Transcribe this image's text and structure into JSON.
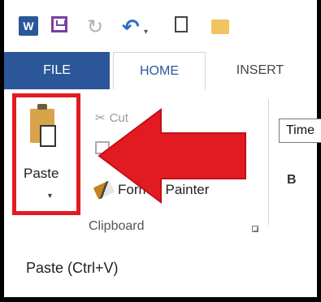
{
  "quick_access": {
    "word_badge": "W",
    "icons": [
      "word-icon",
      "save-icon",
      "repeat-icon",
      "undo-icon",
      "undo-dropdown-icon",
      "new-document-icon",
      "open-folder-icon"
    ]
  },
  "tabs": {
    "file": "FILE",
    "home": "HOME",
    "insert": "INSERT"
  },
  "ribbon": {
    "paste_label": "Paste",
    "cut_label": "Cut",
    "format_painter_label": "Format Painter",
    "clipboard_group_label": "Clipboard",
    "font_name": "Time",
    "bold_label": "B"
  },
  "tooltip": {
    "title": "Paste (Ctrl+V)"
  },
  "colors": {
    "accent": "#2b579a",
    "highlight": "#e21b23"
  }
}
